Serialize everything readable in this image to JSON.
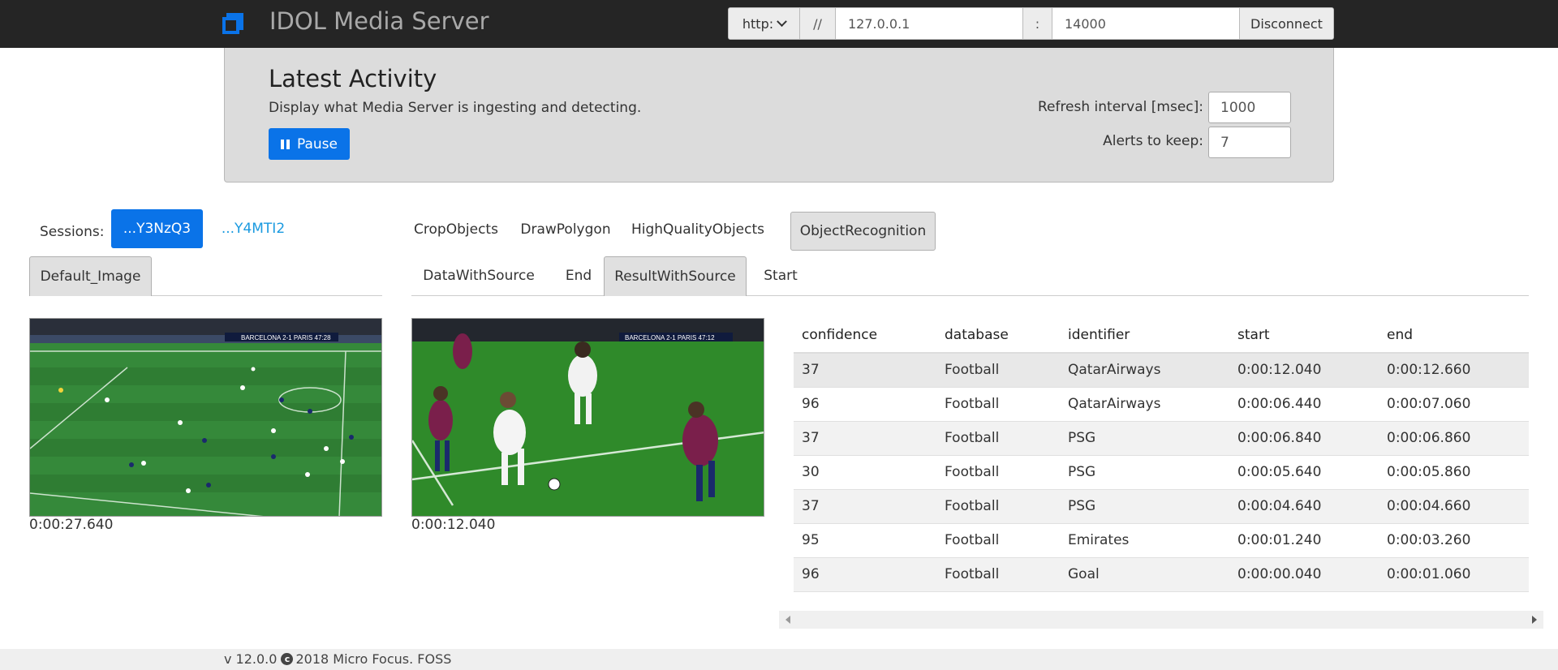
{
  "app": {
    "title": "IDOL Media Server"
  },
  "connection": {
    "protocol": "http:",
    "separator1": "//",
    "host": "127.0.0.1",
    "separator2": ":",
    "port": "14000",
    "disconnect_label": "Disconnect"
  },
  "activity": {
    "title": "Latest Activity",
    "subtitle": "Display what Media Server is ingesting and detecting.",
    "pause_label": "Pause",
    "refresh_label": "Refresh interval [msec]:",
    "refresh_value": "1000",
    "alerts_label": "Alerts to keep:",
    "alerts_value": "7"
  },
  "sessions": {
    "label": "Sessions:",
    "items": [
      "...Y3NzQ3",
      "...Y4MTI2"
    ]
  },
  "left_tabs": [
    "Default_Image"
  ],
  "event_tabs": {
    "row1": [
      "CropObjects",
      "DrawPolygon",
      "HighQualityObjects",
      "ObjectRecognition"
    ],
    "row2": [
      "DataWithSource",
      "End",
      "ResultWithSource",
      "Start"
    ]
  },
  "frames": {
    "left_timestamp": "0:00:27.640",
    "right_timestamp": "0:00:12.040",
    "score_left": {
      "home": "BARCELONA",
      "score": "2-1",
      "away": "PARIS",
      "clock": "47:28"
    },
    "score_right": {
      "home": "BARCELONA",
      "score": "2-1",
      "away": "PARIS",
      "clock": "47:12"
    }
  },
  "table": {
    "headers": [
      "confidence",
      "database",
      "identifier",
      "start",
      "end"
    ],
    "rows": [
      [
        "37",
        "Football",
        "QatarAirways",
        "0:00:12.040",
        "0:00:12.660"
      ],
      [
        "96",
        "Football",
        "QatarAirways",
        "0:00:06.440",
        "0:00:07.060"
      ],
      [
        "37",
        "Football",
        "PSG",
        "0:00:06.840",
        "0:00:06.860"
      ],
      [
        "30",
        "Football",
        "PSG",
        "0:00:05.640",
        "0:00:05.860"
      ],
      [
        "37",
        "Football",
        "PSG",
        "0:00:04.640",
        "0:00:04.660"
      ],
      [
        "95",
        "Football",
        "Emirates",
        "0:00:01.240",
        "0:00:03.260"
      ],
      [
        "96",
        "Football",
        "Goal",
        "0:00:00.040",
        "0:00:01.060"
      ]
    ]
  },
  "footer": {
    "version": "v 12.0.0",
    "copyright": "2018 Micro Focus. FOSS"
  },
  "colors": {
    "accent": "#0a73e8",
    "navbar": "#252525",
    "pitch": "#2f8a2a"
  }
}
